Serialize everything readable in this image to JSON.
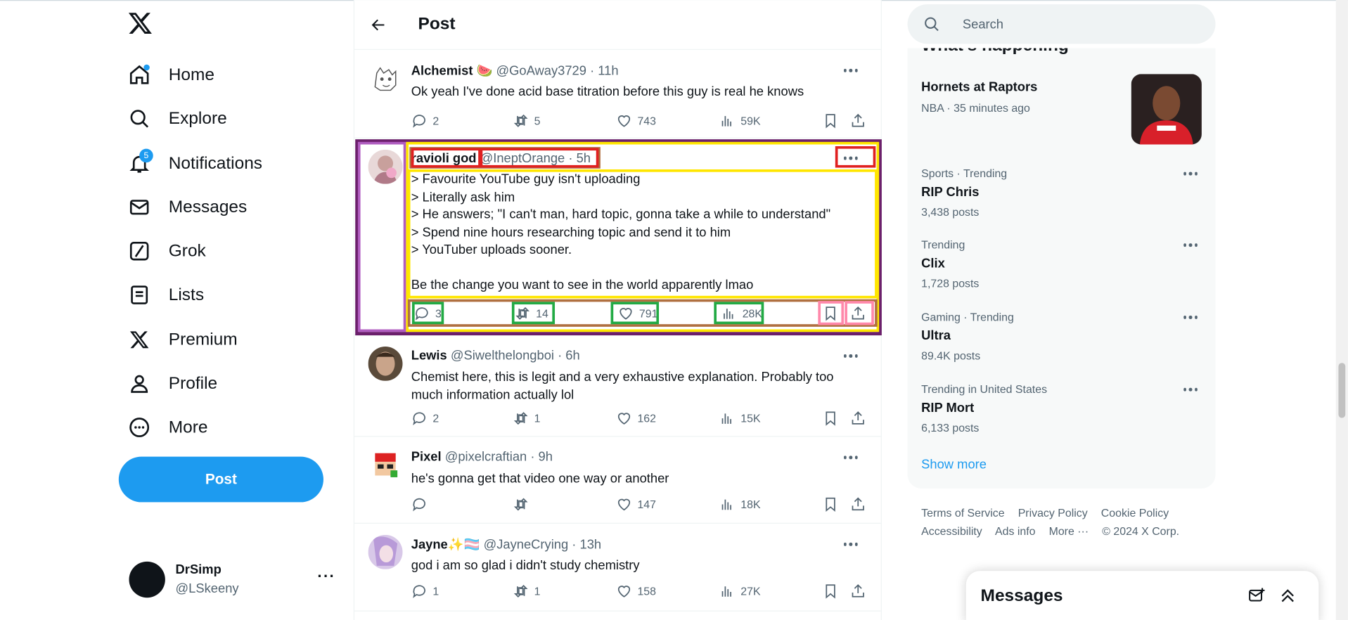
{
  "nav": {
    "items": [
      {
        "label": "Home",
        "icon": "home-icon"
      },
      {
        "label": "Explore",
        "icon": "search-icon"
      },
      {
        "label": "Notifications",
        "icon": "bell-icon",
        "badge": "5"
      },
      {
        "label": "Messages",
        "icon": "envelope-icon"
      },
      {
        "label": "Grok",
        "icon": "grok-icon"
      },
      {
        "label": "Lists",
        "icon": "list-icon"
      },
      {
        "label": "Premium",
        "icon": "x-logo-icon"
      },
      {
        "label": "Profile",
        "icon": "person-icon"
      },
      {
        "label": "More",
        "icon": "more-circle-icon"
      }
    ],
    "post_label": "Post",
    "account": {
      "name": "DrSimp",
      "handle": "@LSkeeny",
      "more": "···"
    }
  },
  "header": {
    "title": "Post"
  },
  "tweets": [
    {
      "name": "Alchemist 🍉",
      "handle": "@GoAway3729 · 11h",
      "text": "Ok yeah I've done acid base titration before this guy is real he knows",
      "replies": "2",
      "reposts": "5",
      "likes": "743",
      "views": "59K"
    },
    {
      "name": "ravioli god",
      "handle": "@IneptOrange · 5h",
      "text": "> Favourite YouTube guy isn't uploading\n> Literally ask him\n> He answers; \"I can't man, hard topic, gonna take a while to understand\"\n> Spend nine hours researching topic and send it to him\n> YouTuber uploads sooner.\n\nBe the change you want to see in the world apparently lmao",
      "replies": "3",
      "reposts": "14",
      "likes": "791",
      "views": "28K"
    },
    {
      "name": "Lewis",
      "handle": "@Siwelthelongboi · 6h",
      "text": "Chemist here, this is legit and a very exhaustive explanation. Probably too much information actually lol",
      "replies": "2",
      "reposts": "1",
      "likes": "162",
      "views": "15K"
    },
    {
      "name": "Pixel",
      "handle": "@pixelcraftian · 9h",
      "text": "he's gonna get that video one way or another",
      "replies": "",
      "reposts": "",
      "likes": "147",
      "views": "18K"
    },
    {
      "name": "Jayne✨🏳️‍⚧️",
      "handle": "@JayneCrying · 13h",
      "text": "god i am so glad i didn't study chemistry",
      "replies": "1",
      "reposts": "1",
      "likes": "158",
      "views": "27K"
    }
  ],
  "search": {
    "placeholder": "Search"
  },
  "trends": {
    "title": "What's happening",
    "event": {
      "name": "Hornets at Raptors",
      "meta": "NBA · 35 minutes ago"
    },
    "items": [
      {
        "meta": "Sports · Trending",
        "name": "RIP Chris",
        "count": "3,438 posts"
      },
      {
        "meta": "Trending",
        "name": "Clix",
        "count": "1,728 posts"
      },
      {
        "meta": "Gaming · Trending",
        "name": "Ultra",
        "count": "89.4K posts"
      },
      {
        "meta": "Trending in United States",
        "name": "RIP Mort",
        "count": "6,133 posts"
      }
    ],
    "show_more": "Show more"
  },
  "footer": {
    "links": [
      "Terms of Service",
      "Privacy Policy",
      "Cookie Policy",
      "Accessibility",
      "Ads info",
      "More ···"
    ],
    "copyright": "© 2024 X Corp."
  },
  "messages_drawer": {
    "title": "Messages"
  },
  "colors": {
    "accent": "#1d9bf0",
    "text": "#0f1419",
    "muted": "#536471"
  }
}
